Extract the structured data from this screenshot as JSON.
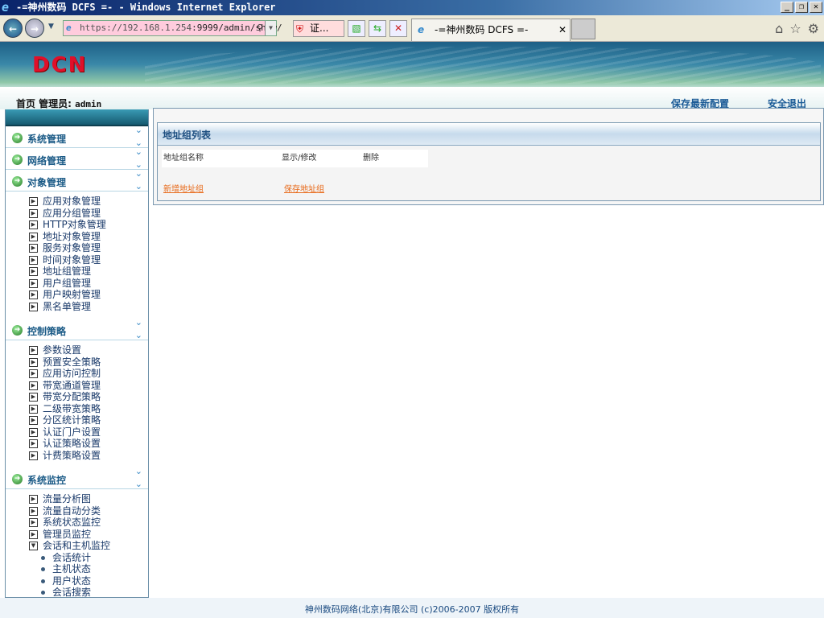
{
  "window": {
    "title": "-=神州数码 DCFS =- - Windows Internet Explorer"
  },
  "browser": {
    "url_host": "https://192.168.1.254",
    "url_rest": ":9999/admin/show/",
    "cert_label": "证...",
    "tab_title": "-=神州数码 DCFS =-"
  },
  "banner": {
    "logo": "DCN"
  },
  "header": {
    "breadcrumb": "首页 管理员:",
    "user": "admin",
    "save_config": "保存最新配置",
    "logout": "安全退出"
  },
  "sidebar": {
    "sections": [
      {
        "label": "系统管理",
        "items": []
      },
      {
        "label": "网络管理",
        "items": []
      },
      {
        "label": "对象管理",
        "items": [
          "应用对象管理",
          "应用分组管理",
          "HTTP对象管理",
          "地址对象管理",
          "服务对象管理",
          "时间对象管理",
          "地址组管理",
          "用户组管理",
          "用户映射管理",
          "黑名单管理"
        ]
      },
      {
        "label": "控制策略",
        "items": [
          "参数设置",
          "预置安全策略",
          "应用访问控制",
          "带宽通道管理",
          "带宽分配策略",
          "二级带宽策略",
          "分区统计策略",
          "认证门户设置",
          "认证策略设置",
          "计费策略设置"
        ]
      },
      {
        "label": "系统监控",
        "items": [
          "流量分析图",
          "流量自动分类",
          "系统状态监控",
          "管理员监控",
          "会话和主机监控"
        ],
        "subitems": [
          "会话统计",
          "主机状态",
          "用户状态",
          "会话搜索"
        ]
      }
    ]
  },
  "main": {
    "panel_title": "地址组列表",
    "columns": [
      "地址组名称",
      "显示/修改",
      "删除"
    ],
    "add_link": "新增地址组",
    "save_link": "保存地址组"
  },
  "footer": {
    "text": "神州数码网络(北京)有限公司 (c)2006-2007 版权所有"
  }
}
